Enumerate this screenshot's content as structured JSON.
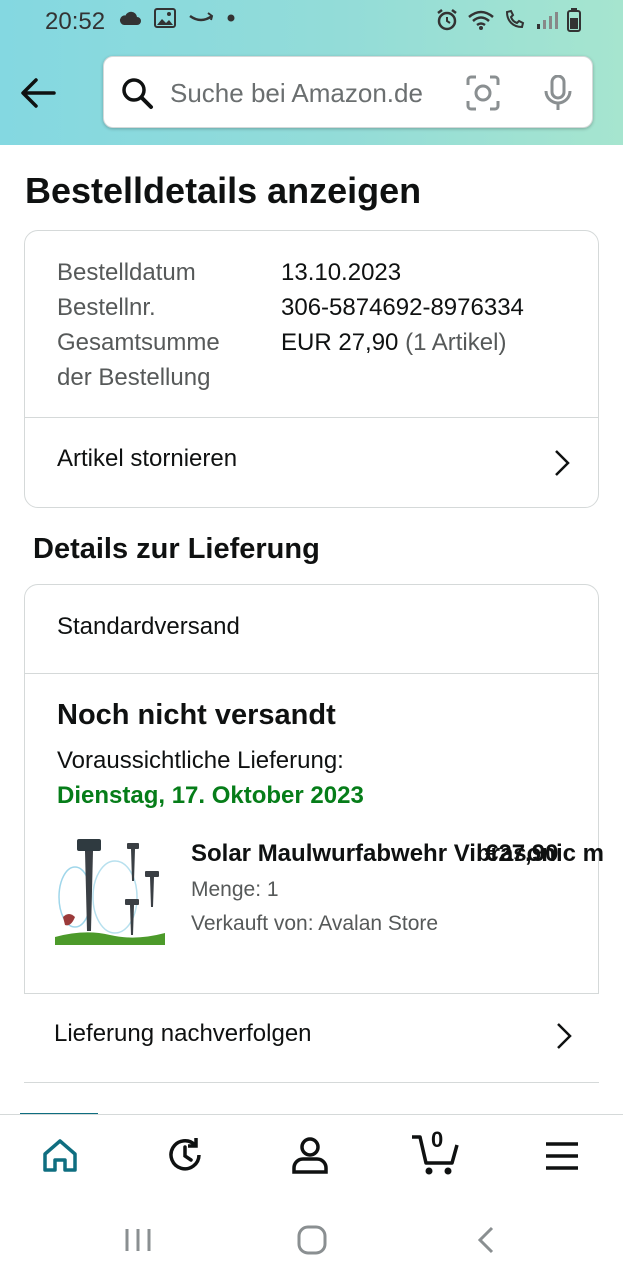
{
  "status_bar": {
    "time": "20:52"
  },
  "header": {
    "search_placeholder": "Suche bei Amazon.de"
  },
  "page_title": "Bestelldetails anzeigen",
  "order": {
    "date_label": "Bestelldatum",
    "date_value": "13.10.2023",
    "number_label": "Bestellnr.",
    "number_value": "306-5874692-8976334",
    "total_label_line1": "Gesamtsumme",
    "total_label_line2": "der Bestellung",
    "total_value": "EUR 27,90",
    "total_items": "(1 Artikel)",
    "cancel_label": "Artikel stornieren"
  },
  "delivery": {
    "section_title": "Details zur Lieferung",
    "shipping_method": "Standardversand",
    "status": "Noch nicht versandt",
    "expected_label": "Voraussichtliche Lieferung:",
    "expected_date": "Dienstag, 17. Oktober 2023",
    "item": {
      "name": "Solar Maulwurfabwehr Vibrasonic m",
      "price": "€27,90",
      "quantity": "Menge: 1",
      "seller": "Verkauft von: Avalan Store"
    },
    "track_label": "Lieferung nachverfolgen"
  },
  "bottom_nav": {
    "cart_count": "0"
  },
  "icons": {
    "back": "arrow-left-icon",
    "search": "search-icon",
    "camera": "camera-scan-icon",
    "mic": "microphone-icon",
    "home": "home-icon",
    "orders": "reorder-icon",
    "account": "account-icon",
    "cart": "cart-icon",
    "menu": "menu-icon"
  },
  "colors": {
    "header_gradient_start": "#84d8e1",
    "header_gradient_end": "#a6e5cf",
    "delivery_date": "#067d19",
    "active_nav": "#0f6e80"
  }
}
